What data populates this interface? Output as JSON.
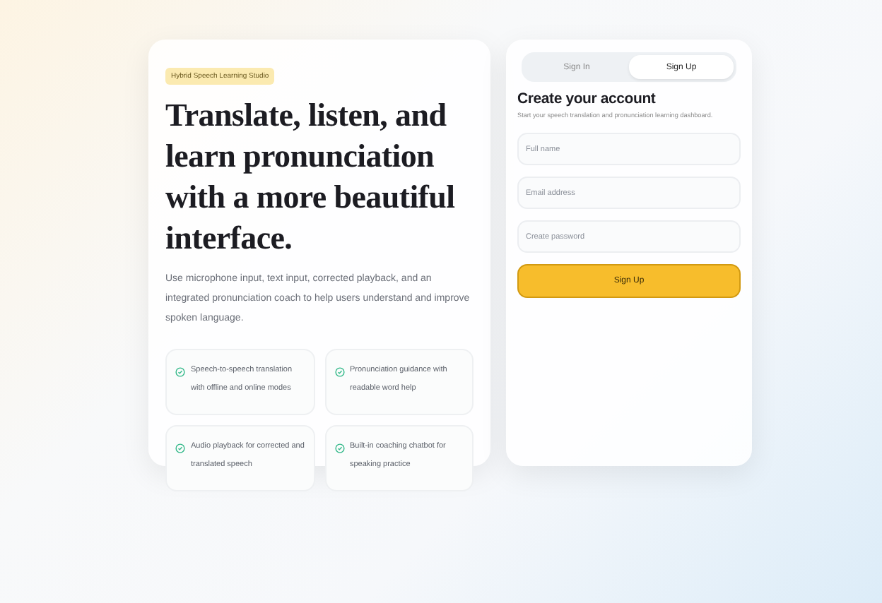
{
  "hero": {
    "badge": "Hybrid Speech Learning Studio",
    "heading": "Translate, listen, and learn pronunciation with a more beautiful interface.",
    "description": "Use microphone input, text input, corrected playback, and an integrated pronunciation coach to help users understand and improve spoken language.",
    "features": [
      {
        "text": "Speech-to-speech translation with offline and online modes"
      },
      {
        "text": "Pronunciation guidance with readable word help"
      },
      {
        "text": "Audio playback for corrected and translated speech"
      },
      {
        "text": "Built-in coaching chatbot for speaking practice"
      }
    ]
  },
  "auth": {
    "tabs": [
      {
        "label": "Sign In",
        "selected": false
      },
      {
        "label": "Sign Up",
        "selected": true
      }
    ],
    "title": "Create your account",
    "subtitle": "Start your speech translation and pronunciation learning dashboard.",
    "fields": [
      {
        "placeholder": "Full name"
      },
      {
        "placeholder": "Email address"
      },
      {
        "placeholder": "Create password"
      }
    ],
    "submit": "Sign Up"
  }
}
